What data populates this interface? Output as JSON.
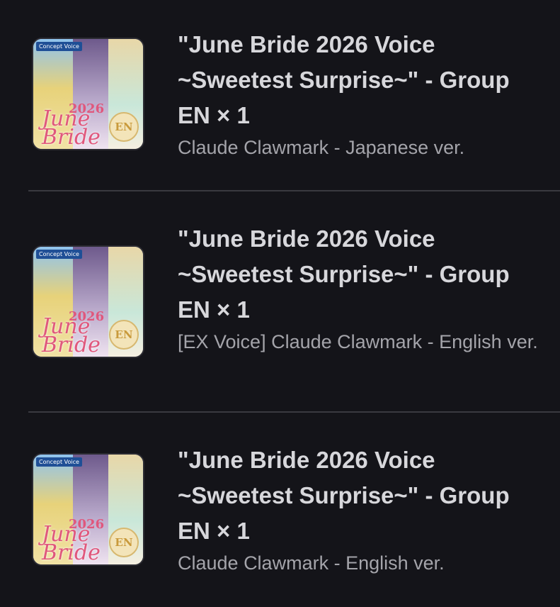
{
  "items": [
    {
      "title": "\"June Bride 2026 Voice ~Sweetest Surprise~\" - Group EN × 1",
      "subtitle": "Claude Clawmark - Japanese ver.",
      "thumb": {
        "tag": "Concept Voice",
        "year": "2026",
        "art_text": "June Bride",
        "badge": "EN"
      }
    },
    {
      "title": "\"June Bride 2026 Voice ~Sweetest Surprise~\" - Group EN × 1",
      "subtitle": "[EX Voice] Claude Clawmark - English ver.",
      "thumb": {
        "tag": "Concept Voice",
        "year": "2026",
        "art_text": "June Bride",
        "badge": "EN"
      }
    },
    {
      "title": "\"June Bride 2026 Voice ~Sweetest Surprise~\" - Group EN × 1",
      "subtitle": "Claude Clawmark - English ver.",
      "thumb": {
        "tag": "Concept Voice",
        "year": "2026",
        "art_text": "June Bride",
        "badge": "EN"
      }
    }
  ]
}
